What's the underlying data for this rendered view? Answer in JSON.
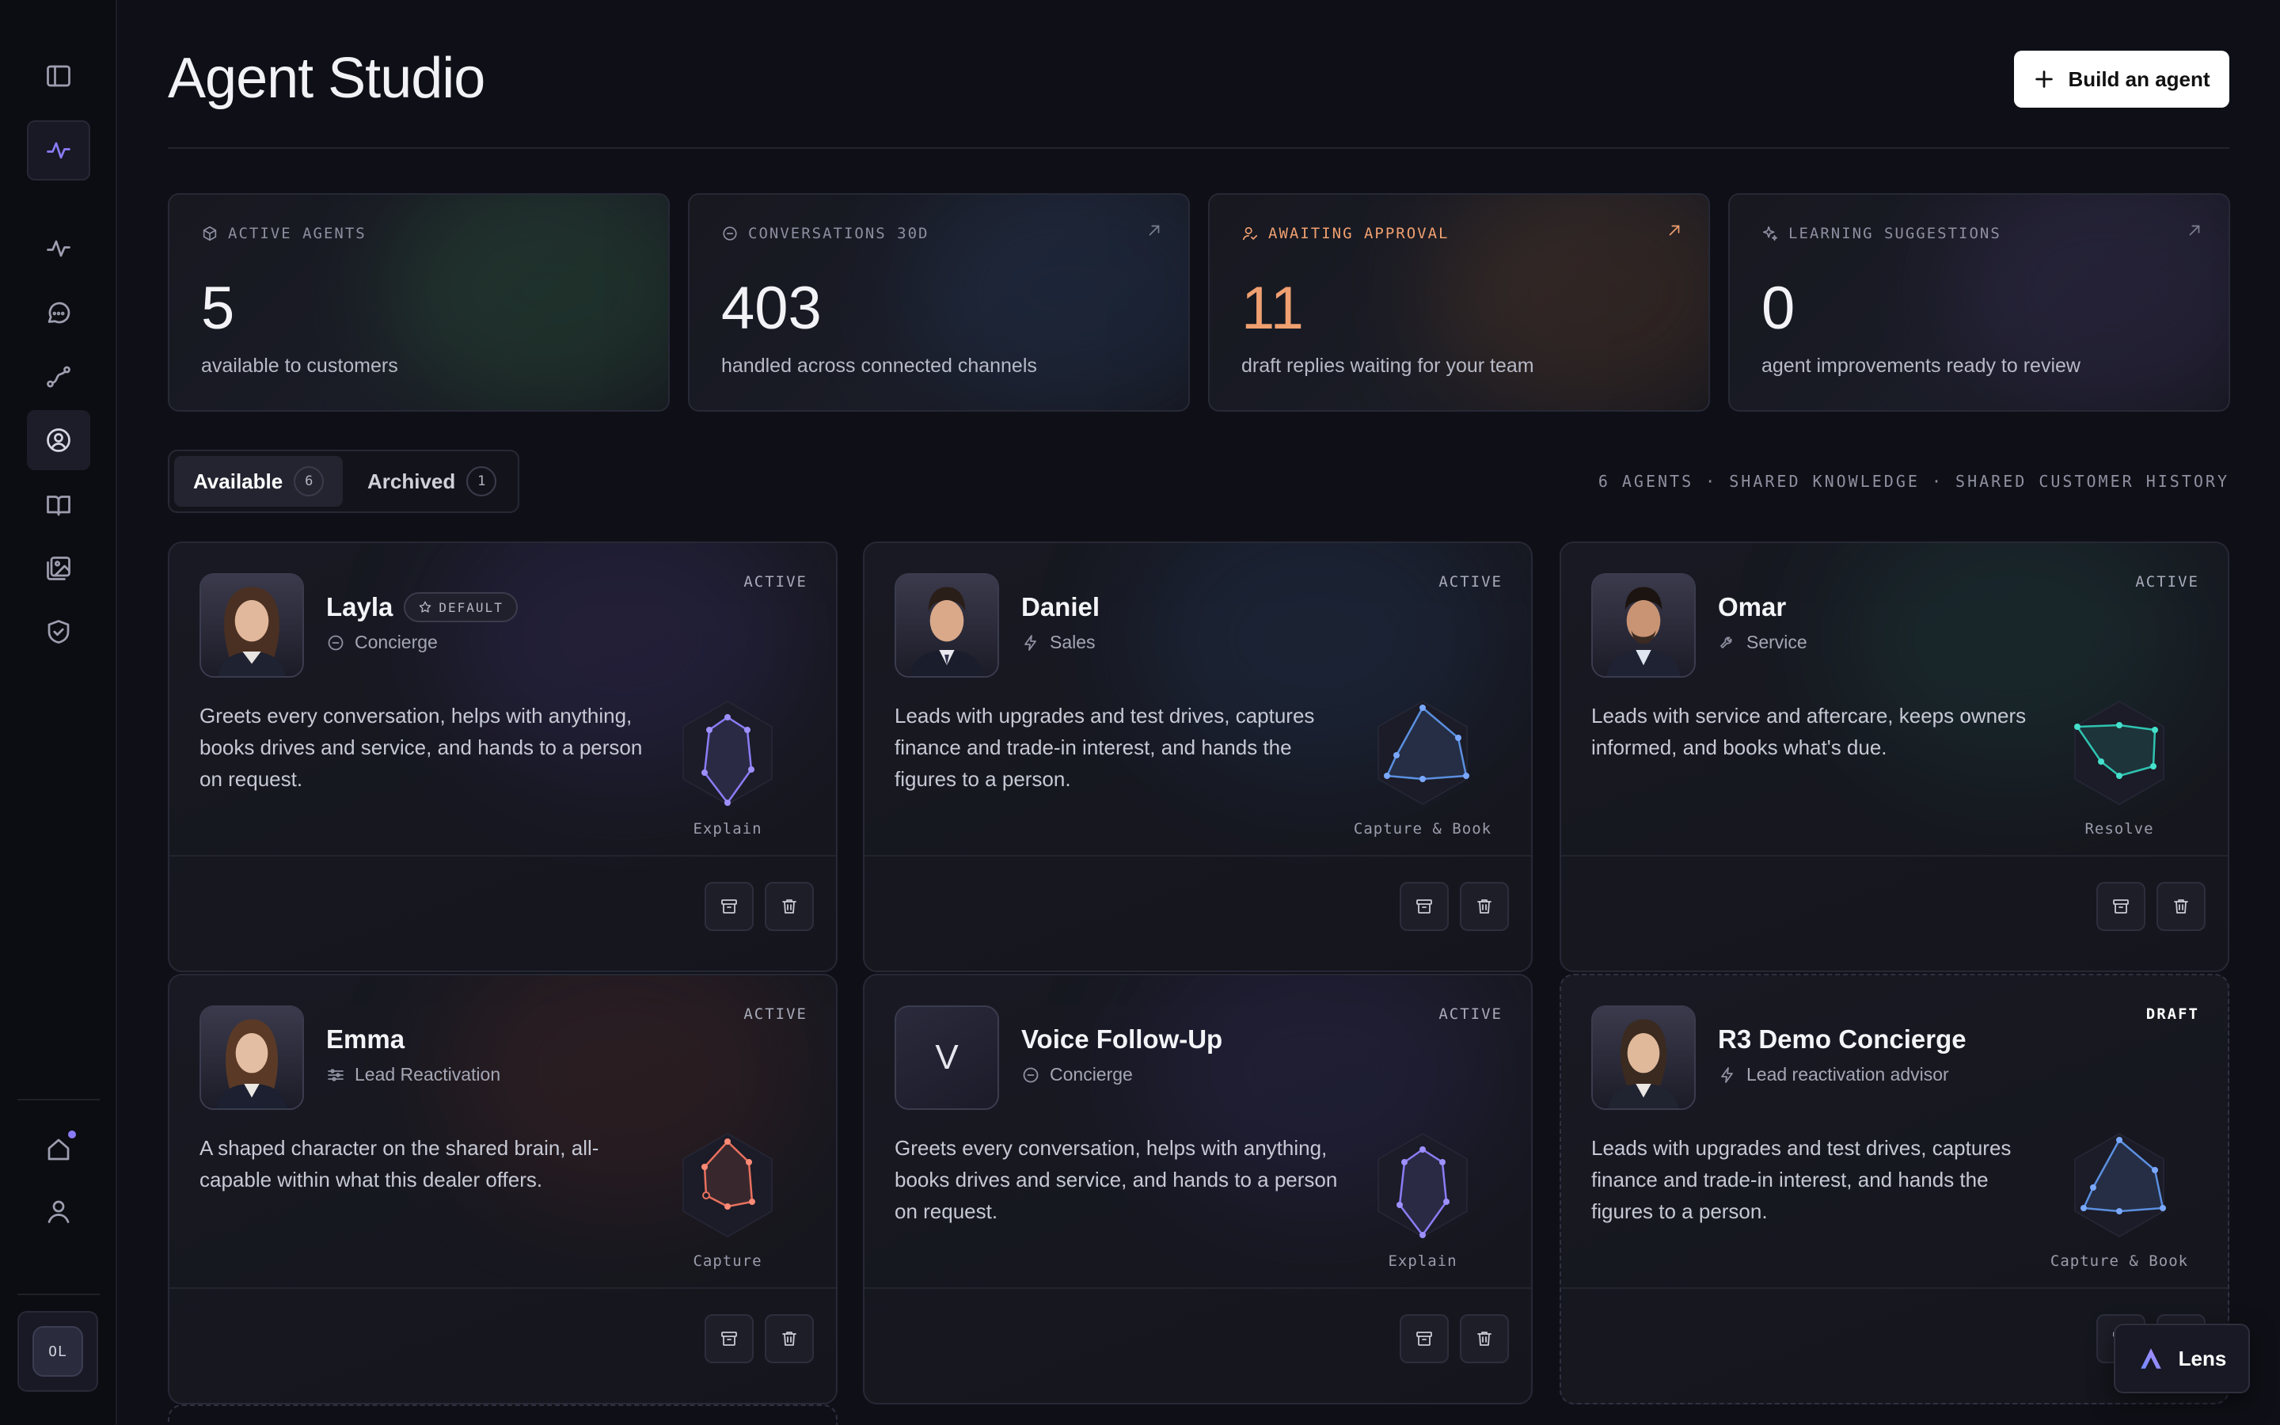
{
  "sidebar": {
    "user_initials": "OL"
  },
  "header": {
    "title": "Agent Studio",
    "build_button": "Build an agent"
  },
  "stats": [
    {
      "label": "ACTIVE AGENTS",
      "value": "5",
      "sub": "available to customers",
      "icon": "cube-icon"
    },
    {
      "label": "CONVERSATIONS 30D",
      "value": "403",
      "sub": "handled across connected channels",
      "icon": "chat-icon"
    },
    {
      "label": "AWAITING APPROVAL",
      "value": "11",
      "sub": "draft replies waiting for your team",
      "icon": "user-check-icon",
      "accent": "#f0a070"
    },
    {
      "label": "LEARNING SUGGESTIONS",
      "value": "0",
      "sub": "agent improvements ready to review",
      "icon": "sparkle-icon"
    }
  ],
  "tabs": [
    {
      "label": "Available",
      "count": "6"
    },
    {
      "label": "Archived",
      "count": "1"
    }
  ],
  "meta_line": "6 AGENTS · SHARED KNOWLEDGE · SHARED CUSTOMER HISTORY",
  "agents": [
    {
      "name": "Layla",
      "badge": "DEFAULT",
      "role": "Concierge",
      "status": "ACTIVE",
      "description": "Greets every conversation, helps with anything, books drives and service, and hands to a person on request.",
      "strength": "Explain",
      "color": "#8b7cf6"
    },
    {
      "name": "Daniel",
      "role": "Sales",
      "status": "ACTIVE",
      "description": "Leads with upgrades and test drives, captures finance and trade-in interest, and hands the figures to a person.",
      "strength": "Capture & Book",
      "color": "#5b8fe0"
    },
    {
      "name": "Omar",
      "role": "Service",
      "status": "ACTIVE",
      "description": "Leads with service and aftercare, keeps owners informed, and books what's due.",
      "strength": "Resolve",
      "color": "#2fc3b0"
    },
    {
      "name": "Emma",
      "role": "Lead Reactivation",
      "status": "ACTIVE",
      "description": "A shaped character on the shared brain, all-capable within what this dealer offers.",
      "strength": "Capture",
      "color": "#e8705e"
    },
    {
      "name": "Voice Follow-Up",
      "initial": "V",
      "role": "Concierge",
      "status": "ACTIVE",
      "description": "Greets every conversation, helps with anything, books drives and service, and hands to a person on request.",
      "strength": "Explain",
      "color": "#8b7cf6"
    },
    {
      "name": "R3 Demo Concierge",
      "role": "Lead reactivation advisor",
      "status": "DRAFT",
      "description": "Leads with upgrades and test drives, captures finance and trade-in interest, and hands the figures to a person.",
      "strength": "Capture & Book",
      "color": "#5b8fe0"
    }
  ],
  "lens": {
    "label": "Lens"
  }
}
